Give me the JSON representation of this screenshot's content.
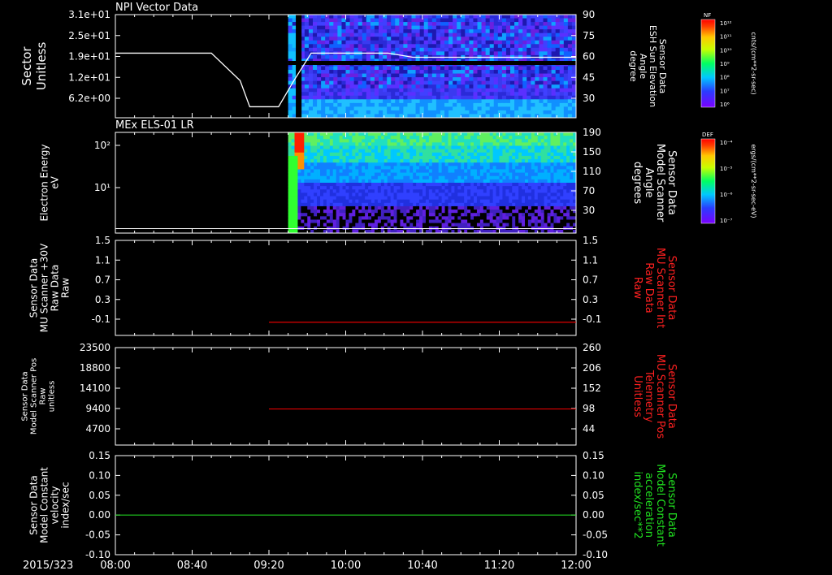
{
  "time_axis": {
    "date_label": "2015/323",
    "ticks": [
      "08:00",
      "08:40",
      "09:20",
      "10:00",
      "10:40",
      "11:20",
      "12:00"
    ]
  },
  "panels": [
    {
      "id": "p1",
      "title": "NPI Vector Data",
      "type": "spectrogram",
      "ylabel": [
        "Sector",
        "Unitless"
      ],
      "left_ticks": [
        "3.1e+01",
        "2.5e+01",
        "1.9e+01",
        "1.2e+01",
        "6.2e+00"
      ],
      "right_ticks": [
        "90",
        "75",
        "60",
        "45",
        "30"
      ],
      "right_label": [
        "Sensor Data",
        "ESH Sun Elevation",
        "Angle",
        "degree"
      ],
      "right_color": "#ffffff",
      "colorbar": {
        "label": "NF",
        "units": "cnts/(cm**2-sr-sec)",
        "ticks": [
          "10¹²",
          "10¹¹",
          "10¹⁰",
          "10⁹",
          "10⁸",
          "10⁷",
          "10⁶"
        ]
      }
    },
    {
      "id": "p2",
      "title": "MEx ELS-01 LR",
      "type": "spectrogram",
      "ylabel": [
        "Electron Energy",
        "eV"
      ],
      "left_ticks": [
        "10²",
        "10¹"
      ],
      "right_ticks": [
        "190",
        "150",
        "110",
        "70",
        "30"
      ],
      "right_label": [
        "Sensor Data",
        "Model Scanner",
        "Angle",
        "degrees"
      ],
      "right_color": "#ffffff",
      "colorbar": {
        "label": "DEF",
        "units": "ergs/(cm**2-sr-sec-eV)",
        "ticks": [
          "10⁻⁴",
          "10⁻⁵",
          "10⁻⁶",
          "10⁻⁷"
        ]
      }
    },
    {
      "id": "p3",
      "type": "line",
      "ylabel": [
        "Sensor Data",
        "MU Scanner +30V",
        "Raw Data",
        "Raw"
      ],
      "left_ticks": [
        "1.5",
        "1.1",
        "0.7",
        "0.3",
        "-0.1"
      ],
      "right_ticks": [
        "1.5",
        "1.1",
        "0.7",
        "0.3",
        "-0.1"
      ],
      "right_label": [
        "Sensor Data",
        "MU Scanner Int",
        "Raw Data",
        "Raw"
      ],
      "right_color": "#ff2020"
    },
    {
      "id": "p4",
      "type": "line",
      "ylabel": [
        "Sensor Data",
        "Model Scanner Pos",
        "Raw",
        "unitless"
      ],
      "left_ticks": [
        "23500",
        "18800",
        "14100",
        "9400",
        "4700"
      ],
      "right_ticks": [
        "260",
        "206",
        "152",
        "98",
        "44"
      ],
      "right_label": [
        "Sensor Data",
        "MU Scanner Pos",
        "Telemetry",
        "Unitless"
      ],
      "right_color": "#ff2020"
    },
    {
      "id": "p5",
      "type": "line",
      "ylabel": [
        "Sensor Data",
        "Model Constant",
        "velocity",
        "index/sec"
      ],
      "left_ticks": [
        "0.15",
        "0.10",
        "0.05",
        "0.00",
        "-0.05",
        "-0.10"
      ],
      "right_ticks": [
        "0.15",
        "0.10",
        "0.05",
        "0.00",
        "-0.05",
        "-0.10"
      ],
      "right_label": [
        "Sensor Data",
        "Model Constant",
        "acceleration",
        "index/sec**2"
      ],
      "right_color": "#20e020"
    }
  ],
  "chart_data": [
    {
      "type": "heatmap",
      "title": "NPI Vector Data",
      "x_range": [
        "08:00",
        "12:00"
      ],
      "ylabel": "Sector Unitless",
      "y_ticks": [
        "6.2e+00",
        "1.2e+01",
        "1.9e+01",
        "2.5e+01",
        "3.1e+01"
      ],
      "data_start": "09:30",
      "gaps": [
        [
          "09:34",
          "09:37"
        ]
      ],
      "overlay_series": {
        "name": "ESH Sun Elevation Angle",
        "units": "degree",
        "ylim": [
          15,
          90
        ],
        "x": [
          "08:00",
          "08:50",
          "09:05",
          "09:10",
          "09:25",
          "09:33",
          "09:42",
          "10:22",
          "10:35",
          "12:00"
        ],
        "y": [
          62,
          62,
          42,
          23,
          23,
          42,
          62,
          62,
          59,
          59
        ]
      }
    },
    {
      "type": "heatmap",
      "title": "MEx ELS-01 LR",
      "x_range": [
        "08:00",
        "12:00"
      ],
      "ylabel": "Electron Energy (eV)",
      "yscale": "log",
      "y_ticks": [
        10,
        100
      ],
      "data_start": "09:30",
      "peak_flux_interval": [
        "09:33",
        "09:38"
      ],
      "overlay_series": {
        "name": "Model Scanner Angle",
        "units": "degrees",
        "ylim": [
          10,
          190
        ],
        "x": [
          "08:00",
          "12:00"
        ],
        "y": [
          18,
          18
        ]
      }
    },
    {
      "type": "line",
      "x_range": [
        "08:00",
        "12:00"
      ],
      "ylim": [
        -0.3,
        1.5
      ],
      "series": [
        {
          "name": "MU Scanner Int Raw Data",
          "x": [
            "09:20",
            "12:00"
          ],
          "y": [
            -0.05,
            -0.05
          ]
        }
      ]
    },
    {
      "type": "line",
      "x_range": [
        "08:00",
        "12:00"
      ],
      "ylim": [
        0,
        23500
      ],
      "right_ylim": [
        -10,
        260
      ],
      "series": [
        {
          "name": "MU Scanner Pos Telemetry",
          "axis": "right",
          "x": [
            "09:20",
            "12:00"
          ],
          "y": [
            90,
            90
          ]
        }
      ]
    },
    {
      "type": "line",
      "x_range": [
        "08:00",
        "12:00"
      ],
      "ylim": [
        -0.1,
        0.15
      ],
      "series": [
        {
          "name": "Model Constant acceleration",
          "x": [
            "08:00",
            "12:00"
          ],
          "y": [
            0.0,
            0.0
          ]
        }
      ]
    }
  ]
}
